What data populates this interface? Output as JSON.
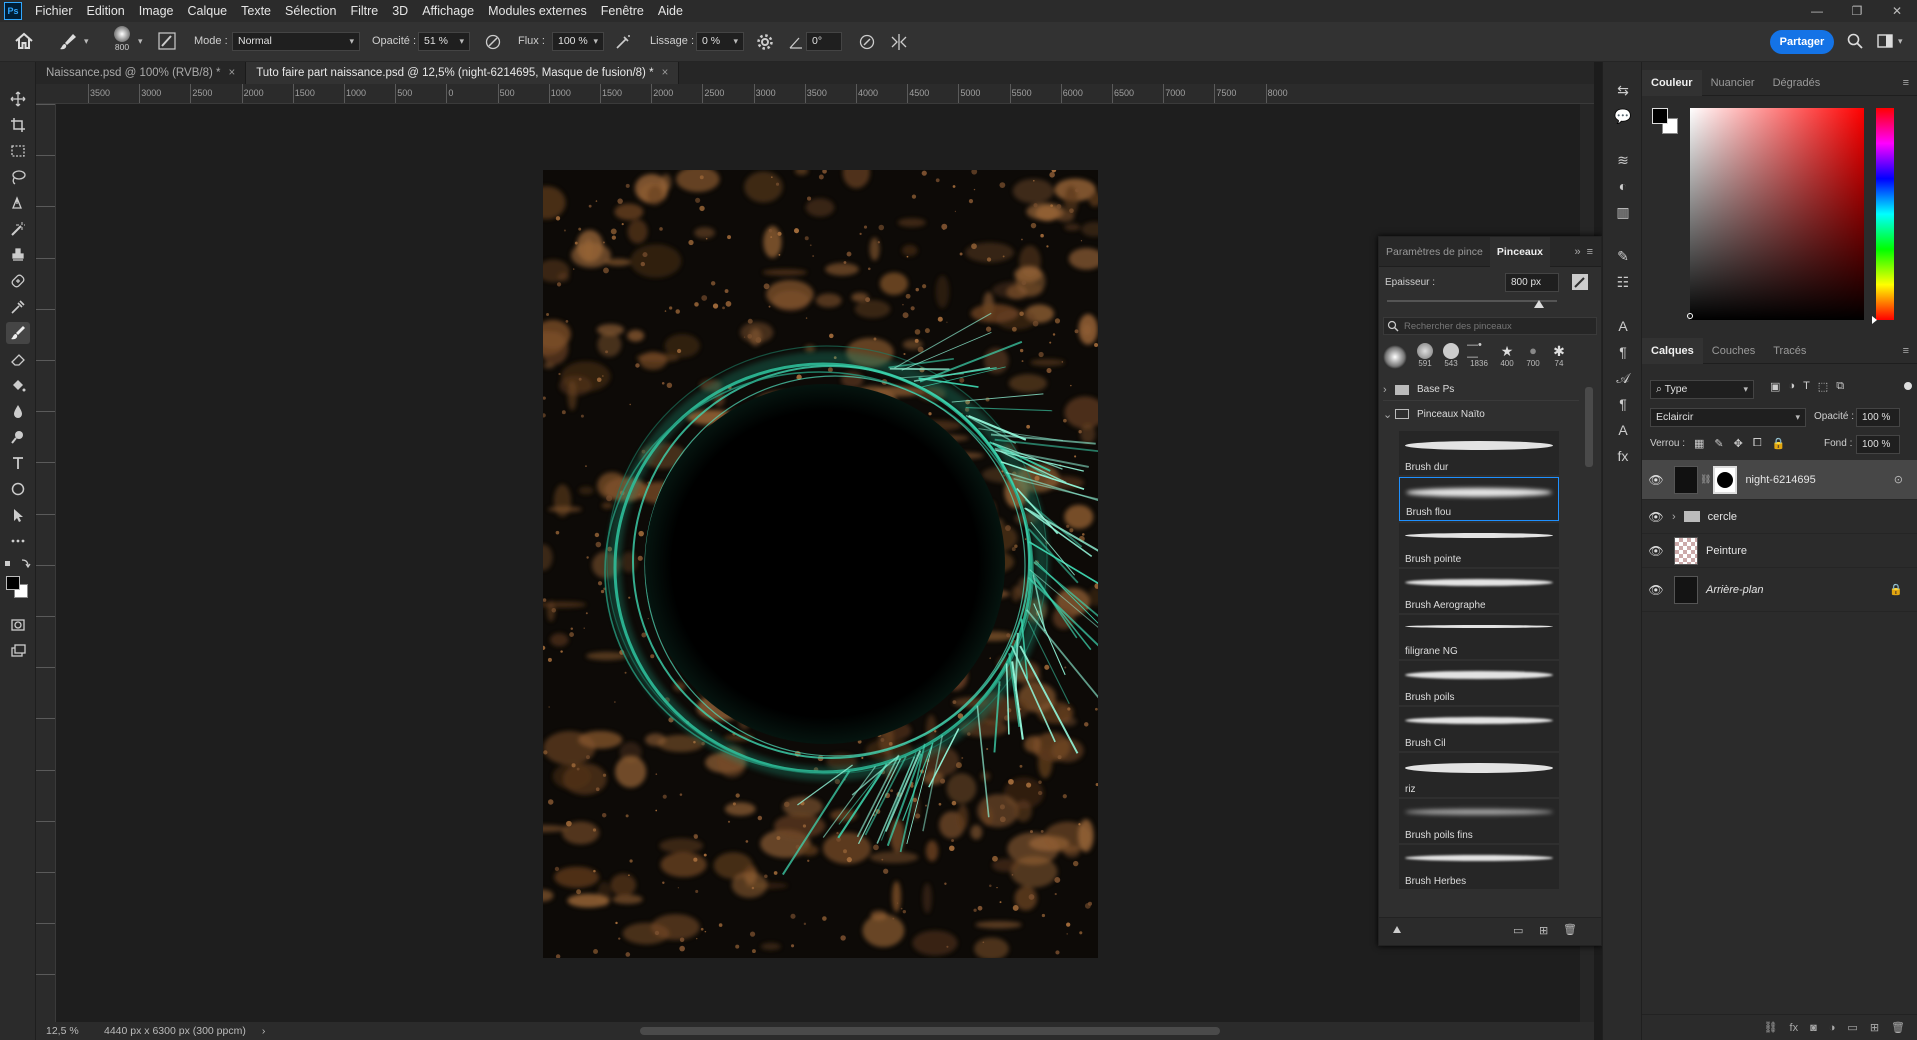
{
  "app": {
    "logo": "Ps"
  },
  "menu": [
    "Fichier",
    "Edition",
    "Image",
    "Calque",
    "Texte",
    "Sélection",
    "Filtre",
    "3D",
    "Affichage",
    "Modules externes",
    "Fenêtre",
    "Aide"
  ],
  "window_controls": {
    "minimize": "—",
    "restore": "❐",
    "close": "✕"
  },
  "options": {
    "brush_size": "800",
    "mode_label": "Mode :",
    "mode_value": "Normal",
    "opacity_label": "Opacité :",
    "opacity_value": "51 %",
    "flux_label": "Flux :",
    "flux_value": "100 %",
    "lissage_label": "Lissage :",
    "lissage_value": "0 %",
    "angle_value": "0°",
    "share_label": "Partager"
  },
  "tabs": [
    {
      "label": "Naissance.psd @ 100% (RVB/8) *",
      "close": "×"
    },
    {
      "label": "Tuto faire part naissance.psd @ 12,5% (night-6214695, Masque de fusion/8) *",
      "close": "×"
    }
  ],
  "ruler_h": [
    "3500",
    "3000",
    "2500",
    "2000",
    "1500",
    "1000",
    "500",
    "0",
    "500",
    "1000",
    "1500",
    "2000",
    "2500",
    "3000",
    "3500",
    "4000",
    "4500",
    "5000",
    "5500",
    "6000",
    "6500",
    "7000",
    "7500",
    "8000"
  ],
  "status": {
    "zoom": "12,5 %",
    "doc_info": "4440 px x 6300 px (300 ppcm)",
    "arrow": "›"
  },
  "brush_panel": {
    "tabs": [
      "Paramètres de pince",
      "Pinceaux"
    ],
    "size_label": "Epaisseur :",
    "size_value": "800 px",
    "search_placeholder": "Rechercher des pinceaux",
    "presets": [
      "",
      "591",
      "543",
      "1836",
      "400",
      "700",
      "74"
    ],
    "groups": [
      "Base Ps",
      "Pinceaux Naïto"
    ],
    "brushes": [
      "Brush dur",
      "Brush flou",
      "Brush pointe",
      "Brush Aerographe",
      "filigrane NG",
      "Brush poils",
      "Brush Cil",
      "riz",
      "Brush poils fins",
      "Brush Herbes"
    ]
  },
  "color_panel": {
    "tabs": [
      "Couleur",
      "Nuancier",
      "Dégradés"
    ]
  },
  "layers_panel": {
    "tabs": [
      "Calques",
      "Couches",
      "Tracés"
    ],
    "filter_value": "Type",
    "blend_mode": "Eclaircir",
    "opacity_label": "Opacité :",
    "opacity_value": "100 %",
    "lock_label": "Verrou :",
    "fill_label": "Fond :",
    "fill_value": "100 %",
    "layers": [
      {
        "name": "night-6214695"
      },
      {
        "name": "cercle"
      },
      {
        "name": "Peinture"
      },
      {
        "name": "Arrière-plan"
      }
    ]
  },
  "colors": {
    "accent": "#1473e6",
    "selection": "#1e90ff",
    "paint": "#8a5a30",
    "ring": "#2fbf9a"
  }
}
